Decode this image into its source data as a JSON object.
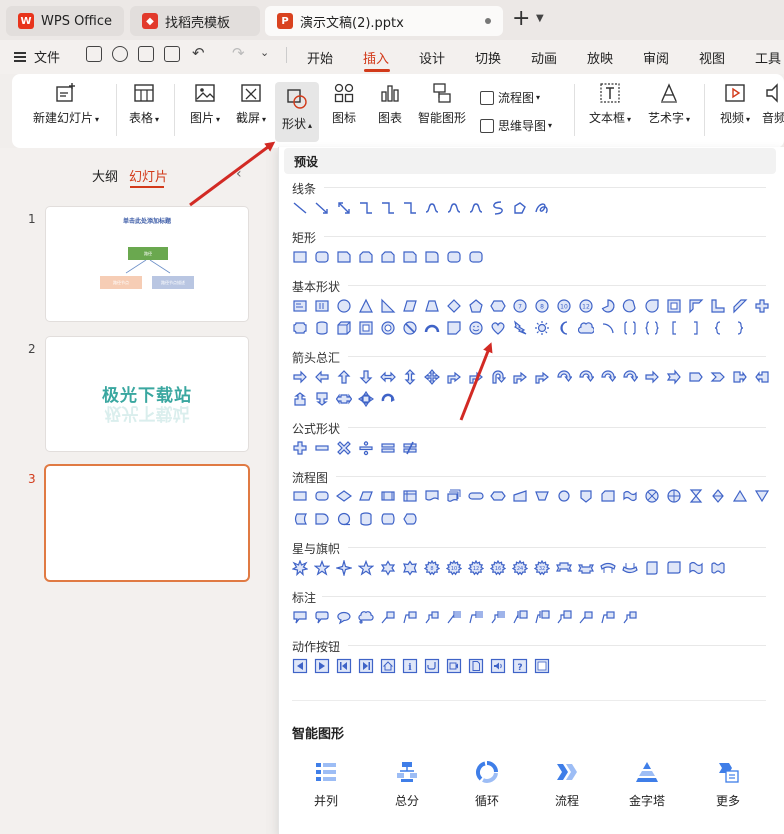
{
  "tabs": [
    {
      "label": "WPS Office",
      "icon": "wps-logo-icon"
    },
    {
      "label": "找稻壳模板",
      "icon": "docer-icon"
    },
    {
      "label": "演示文稿(2).pptx",
      "icon": "presentation-icon"
    }
  ],
  "menu": {
    "file_label": "文件",
    "tabs": [
      "开始",
      "插入",
      "设计",
      "切换",
      "动画",
      "放映",
      "审阅",
      "视图",
      "工具"
    ],
    "active_tab": "插入"
  },
  "ribbon": {
    "new_slide": "新建幻灯片",
    "table": "表格",
    "picture": "图片",
    "screenshot": "截屏",
    "shape": "形状",
    "icon": "图标",
    "chart": "图表",
    "smartart": "智能图形",
    "flowchart": "流程图",
    "mindmap": "思维导图",
    "textbox": "文本框",
    "wordart": "艺术字",
    "video": "视频",
    "audio": "音频"
  },
  "left_panel": {
    "outline_tab": "大纲",
    "slides_tab": "幻灯片",
    "slides": [
      {
        "num": "1",
        "title": "单击此处添加标题",
        "box_top": "路径",
        "box_left": "路径节点",
        "box_right": "路径节点描述"
      },
      {
        "num": "2",
        "watermark": "极光下载站"
      },
      {
        "num": "3"
      }
    ]
  },
  "shape_panel": {
    "header": "预设",
    "sections": {
      "lines": "线条",
      "rectangles": "矩形",
      "basic": "基本形状",
      "arrows": "箭头总汇",
      "equation": "公式形状",
      "flowchart": "流程图",
      "stars": "星与旗帜",
      "callouts": "标注",
      "action": "动作按钮"
    },
    "smart_title": "智能图形",
    "smart_items": [
      "并列",
      "总分",
      "循环",
      "流程",
      "金字塔",
      "更多"
    ]
  },
  "colors": {
    "accent": "#d23a1a",
    "shape_stroke": "#3f63c7",
    "shape_fill": "#dfe6f8",
    "annotation": "#d22a24"
  }
}
